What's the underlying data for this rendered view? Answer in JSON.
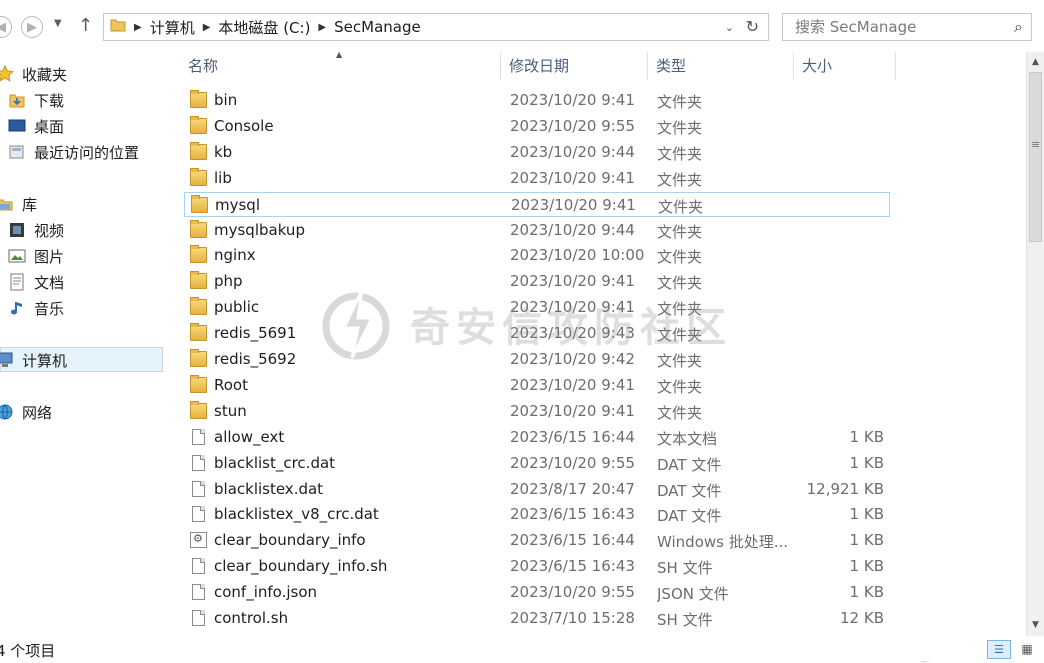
{
  "address": {
    "crumbs": [
      "计算机",
      "本地磁盘 (C:)",
      "SecManage"
    ]
  },
  "search": {
    "placeholder": "搜索 SecManage"
  },
  "nav": {
    "favorites": "收藏夹",
    "downloads": "下载",
    "desktop": "桌面",
    "recent": "最近访问的位置",
    "libraries": "库",
    "videos": "视频",
    "pictures": "图片",
    "documents": "文档",
    "music": "音乐",
    "computer": "计算机",
    "network": "网络"
  },
  "columns": {
    "name": "名称",
    "date": "修改日期",
    "type": "类型",
    "size": "大小"
  },
  "files": [
    {
      "name": "bin",
      "date": "2023/10/20 9:41",
      "type": "文件夹",
      "size": "",
      "icon": "folder"
    },
    {
      "name": "Console",
      "date": "2023/10/20 9:55",
      "type": "文件夹",
      "size": "",
      "icon": "folder"
    },
    {
      "name": "kb",
      "date": "2023/10/20 9:44",
      "type": "文件夹",
      "size": "",
      "icon": "folder"
    },
    {
      "name": "lib",
      "date": "2023/10/20 9:41",
      "type": "文件夹",
      "size": "",
      "icon": "folder"
    },
    {
      "name": "mysql",
      "date": "2023/10/20 9:41",
      "type": "文件夹",
      "size": "",
      "icon": "folder"
    },
    {
      "name": "mysqlbakup",
      "date": "2023/10/20 9:44",
      "type": "文件夹",
      "size": "",
      "icon": "folder"
    },
    {
      "name": "nginx",
      "date": "2023/10/20 10:00",
      "type": "文件夹",
      "size": "",
      "icon": "folder"
    },
    {
      "name": "php",
      "date": "2023/10/20 9:41",
      "type": "文件夹",
      "size": "",
      "icon": "folder"
    },
    {
      "name": "public",
      "date": "2023/10/20 9:41",
      "type": "文件夹",
      "size": "",
      "icon": "folder"
    },
    {
      "name": "redis_5691",
      "date": "2023/10/20 9:43",
      "type": "文件夹",
      "size": "",
      "icon": "folder"
    },
    {
      "name": "redis_5692",
      "date": "2023/10/20 9:42",
      "type": "文件夹",
      "size": "",
      "icon": "folder"
    },
    {
      "name": "Root",
      "date": "2023/10/20 9:41",
      "type": "文件夹",
      "size": "",
      "icon": "folder"
    },
    {
      "name": "stun",
      "date": "2023/10/20 9:41",
      "type": "文件夹",
      "size": "",
      "icon": "folder"
    },
    {
      "name": "allow_ext",
      "date": "2023/6/15 16:44",
      "type": "文本文档",
      "size": "1 KB",
      "icon": "doc"
    },
    {
      "name": "blacklist_crc.dat",
      "date": "2023/10/20 9:55",
      "type": "DAT 文件",
      "size": "1 KB",
      "icon": "doc"
    },
    {
      "name": "blacklistex.dat",
      "date": "2023/8/17 20:47",
      "type": "DAT 文件",
      "size": "12,921 KB",
      "icon": "doc"
    },
    {
      "name": "blacklistex_v8_crc.dat",
      "date": "2023/6/15 16:43",
      "type": "DAT 文件",
      "size": "1 KB",
      "icon": "doc"
    },
    {
      "name": "clear_boundary_info",
      "date": "2023/6/15 16:44",
      "type": "Windows 批处理...",
      "size": "1 KB",
      "icon": "bat"
    },
    {
      "name": "clear_boundary_info.sh",
      "date": "2023/6/15 16:43",
      "type": "SH 文件",
      "size": "1 KB",
      "icon": "doc"
    },
    {
      "name": "conf_info.json",
      "date": "2023/10/20 9:55",
      "type": "JSON 文件",
      "size": "1 KB",
      "icon": "doc"
    },
    {
      "name": "control.sh",
      "date": "2023/7/10 15:28",
      "type": "SH 文件",
      "size": "12 KB",
      "icon": "doc"
    }
  ],
  "selected_index": 4,
  "status": {
    "item_count": "4 个项目"
  },
  "watermark": {
    "text": "奇安信攻防社区"
  }
}
